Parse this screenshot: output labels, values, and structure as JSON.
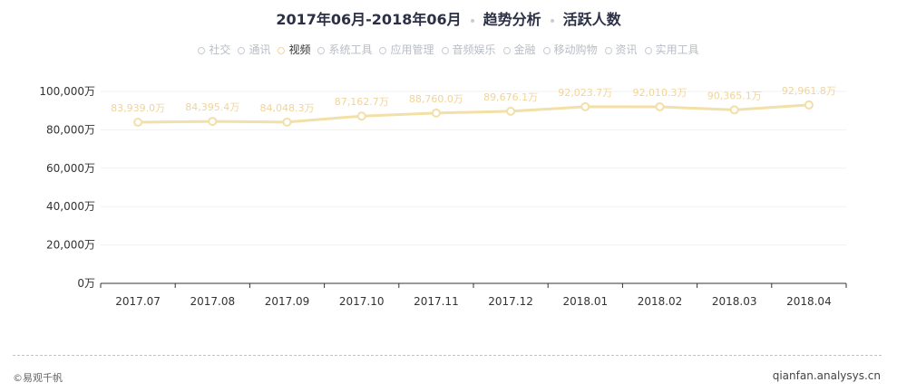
{
  "header": {
    "range": "2017年06月-2018年06月",
    "section": "趋势分析",
    "metric": "活跃人数"
  },
  "legend": {
    "items": [
      "社交",
      "通讯",
      "视频",
      "系统工具",
      "应用管理",
      "音频娱乐",
      "金融",
      "移动购物",
      "资讯",
      "实用工具"
    ],
    "active_index": 2
  },
  "colors": {
    "series": "#f3dfa8",
    "label": "#f0d49a",
    "axis": "#333333",
    "grid": "#f1f1f1"
  },
  "chart_data": {
    "type": "line",
    "categories": [
      "2017.07",
      "2017.08",
      "2017.09",
      "2017.10",
      "2017.11",
      "2017.12",
      "2018.01",
      "2018.02",
      "2018.03",
      "2018.04"
    ],
    "series": [
      {
        "name": "视频",
        "values": [
          83939.0,
          84395.4,
          84048.3,
          87162.7,
          88760.0,
          89676.1,
          92023.7,
          92010.3,
          90365.1,
          92961.8
        ],
        "labels": [
          "83,939.0万",
          "84,395.4万",
          "84,048.3万",
          "87,162.7万",
          "88,760.0万",
          "89,676.1万",
          "92,023.7万",
          "92,010.3万",
          "90,365.1万",
          "92,961.8万"
        ]
      }
    ],
    "ylim": [
      0,
      100000
    ],
    "yticks": [
      0,
      20000,
      40000,
      60000,
      80000,
      100000
    ],
    "ytick_labels": [
      "0万",
      "20,000万",
      "40,000万",
      "60,000万",
      "80,000万",
      "100,000万"
    ],
    "grid": true,
    "legend_position": "top-center"
  },
  "footer": {
    "brand": "©易观千帆",
    "site": "qianfan.analysys.cn"
  }
}
